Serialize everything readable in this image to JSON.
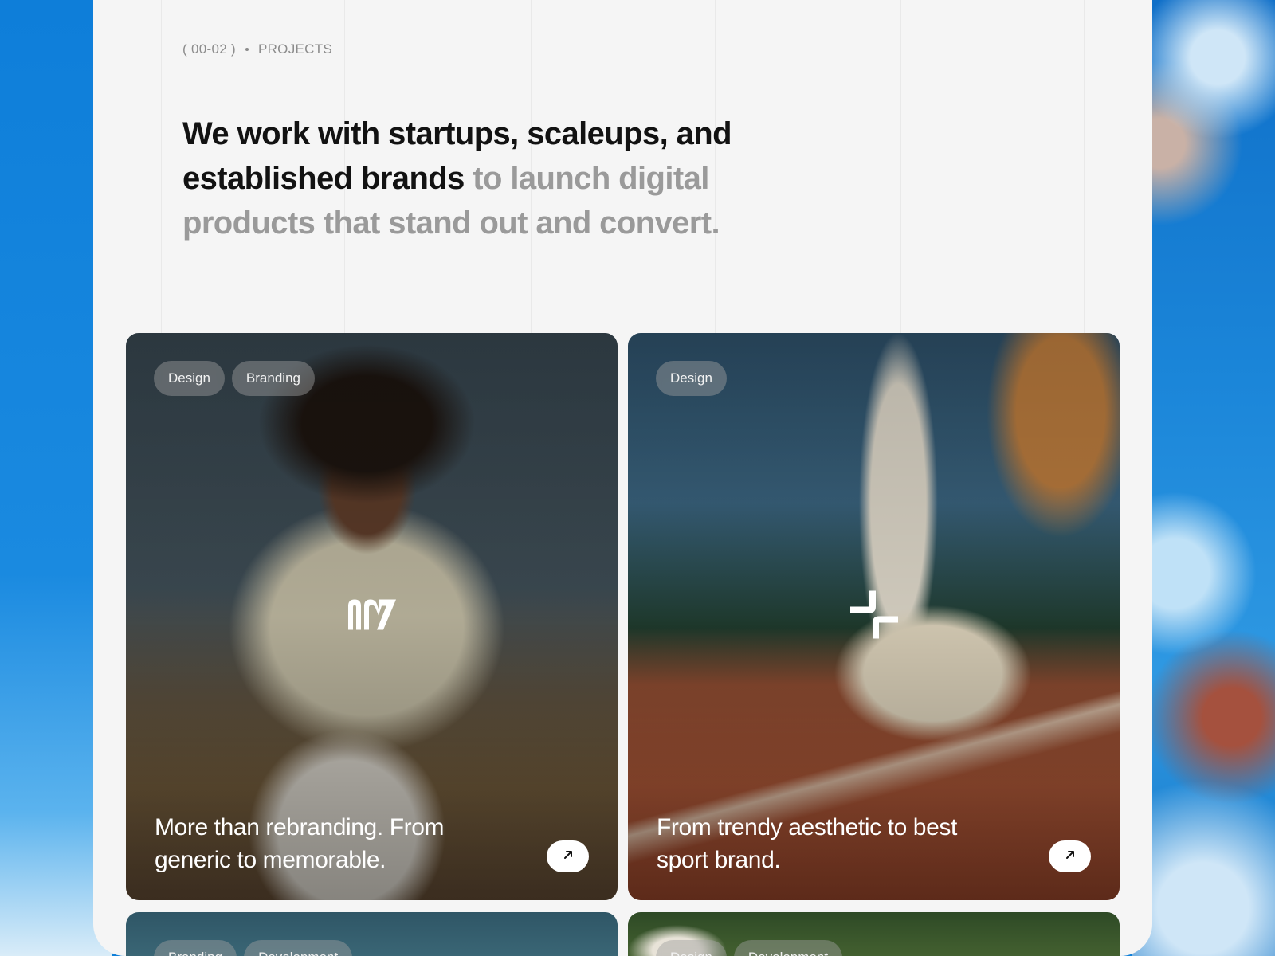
{
  "section": {
    "index": "( 00-02 )",
    "label": "PROJECTS"
  },
  "headline": {
    "dark": "We work with startups, scaleups, and established brands",
    "muted": " to launch digital products that stand out and convert."
  },
  "projects": [
    {
      "tags": [
        "Design",
        "Branding"
      ],
      "title": "More than rebranding. From generic to memorable.",
      "logo_icon": "n7-logo",
      "arrow_icon": "arrow-up-right-icon"
    },
    {
      "tags": [
        "Design"
      ],
      "title": "From trendy aesthetic to best sport brand.",
      "logo_icon": "cross-spark-logo",
      "arrow_icon": "arrow-up-right-icon"
    },
    {
      "tags": [
        "Branding",
        "Development"
      ]
    },
    {
      "tags": [
        "Design",
        "Development"
      ]
    }
  ],
  "colors": {
    "panel_bg": "#f5f5f5",
    "page_bg": "#0f7fd8",
    "headline_dark": "#121212",
    "headline_muted": "#9a9a9a"
  }
}
